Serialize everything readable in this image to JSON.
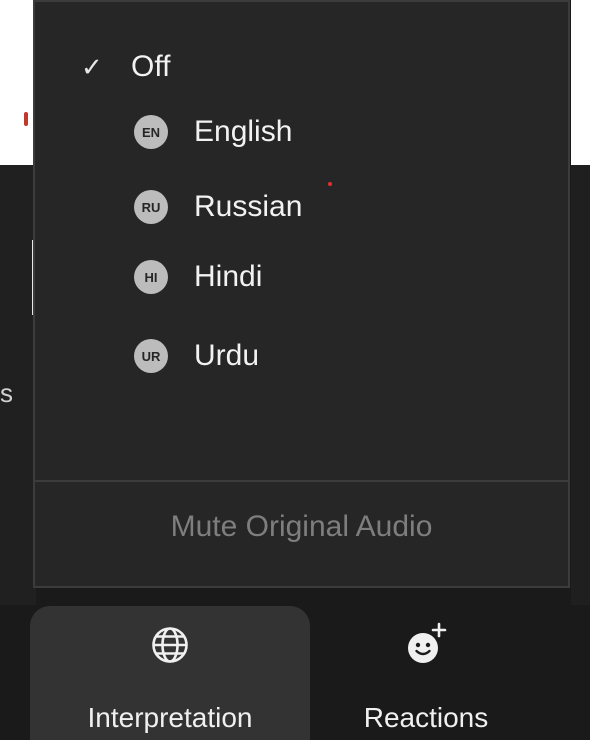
{
  "menu": {
    "off_item": {
      "label": "Off",
      "checked": true,
      "check_glyph": "✓"
    },
    "languages": [
      {
        "code": "EN",
        "label": "English"
      },
      {
        "code": "RU",
        "label": "Russian"
      },
      {
        "code": "HI",
        "label": "Hindi"
      },
      {
        "code": "UR",
        "label": "Urdu"
      }
    ],
    "mute_label": "Mute Original Audio"
  },
  "toolbar": {
    "interpretation": {
      "label": "Interpretation",
      "icon": "globe-icon"
    },
    "reactions": {
      "label": "Reactions",
      "icon": "smiley-add-icon"
    }
  },
  "edge": {
    "letter": "s"
  },
  "colors": {
    "menu_bg": "#262626",
    "badge_bg": "#bcbcbc",
    "notification_dot": "#e03030",
    "disabled_text": "#7e7e7e"
  }
}
